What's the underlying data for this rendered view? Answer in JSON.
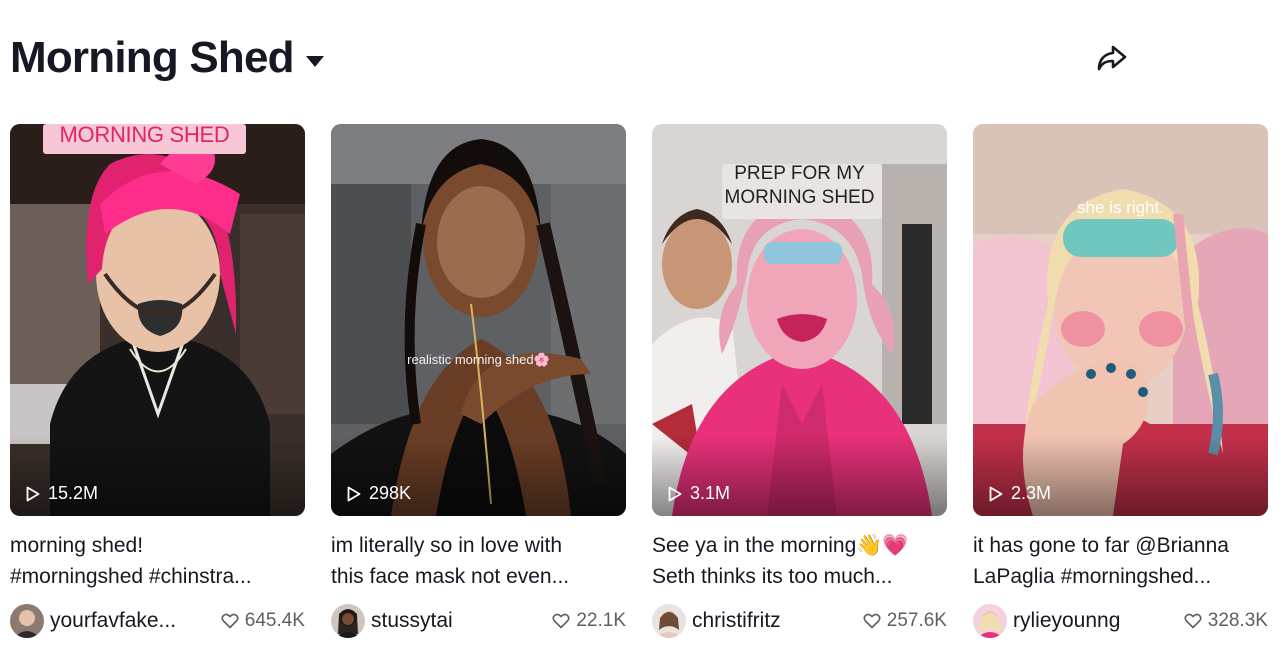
{
  "header": {
    "title": "Morning Shed"
  },
  "icons": {
    "title_dropdown": "caret-down-icon",
    "share": "share-arrow-icon",
    "play": "play-outline-icon",
    "like": "heart-outline-icon"
  },
  "colors": {
    "text": "#161823",
    "muted": "#5e5f66",
    "overlay_pink": "#f7c7d6"
  },
  "videos": [
    {
      "overlay": "MORNING SHED",
      "views": "15.2M",
      "caption_line1": "morning shed!",
      "caption_line2": "#morningshed #chinstra...",
      "author": "yourfavfake...",
      "likes": "645.4K"
    },
    {
      "overlay": "realistic morning shed🌸",
      "views": "298K",
      "caption_line1": "im literally so in love with",
      "caption_line2": "this face mask not even...",
      "author": "stussytai",
      "likes": "22.1K"
    },
    {
      "overlay_line1": "PREP FOR MY",
      "overlay_line2": "MORNING SHED",
      "views": "3.1M",
      "caption_line1": "See ya in the morning👋💗",
      "caption_line2": "Seth thinks its too much...",
      "author": "christifritz",
      "likes": "257.6K"
    },
    {
      "overlay": "she is right.",
      "views": "2.3M",
      "caption_line1": "it has gone to far @Brianna",
      "caption_line2": "LaPaglia #morningshed...",
      "author": "rylieyounng",
      "likes": "328.3K"
    }
  ]
}
